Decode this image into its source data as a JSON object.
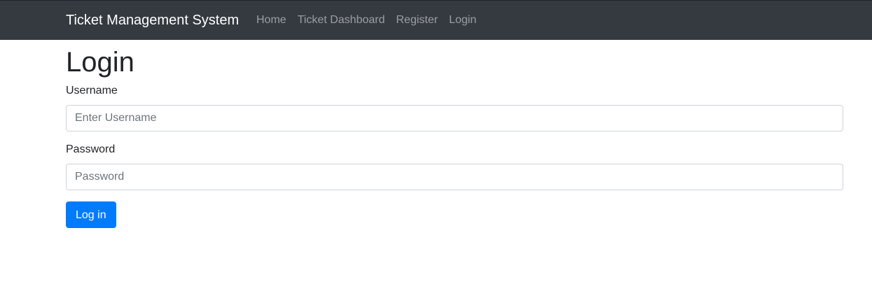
{
  "navbar": {
    "brand": "Ticket Management System",
    "links": [
      {
        "label": "Home"
      },
      {
        "label": "Ticket Dashboard"
      },
      {
        "label": "Register"
      },
      {
        "label": "Login"
      }
    ],
    "background": "#343a40"
  },
  "main": {
    "title": "Login",
    "username": {
      "label": "Username",
      "placeholder": "Enter Username",
      "value": ""
    },
    "password": {
      "label": "Password",
      "placeholder": "Password",
      "value": ""
    },
    "submit_label": "Log in",
    "accent": "#007bff"
  }
}
